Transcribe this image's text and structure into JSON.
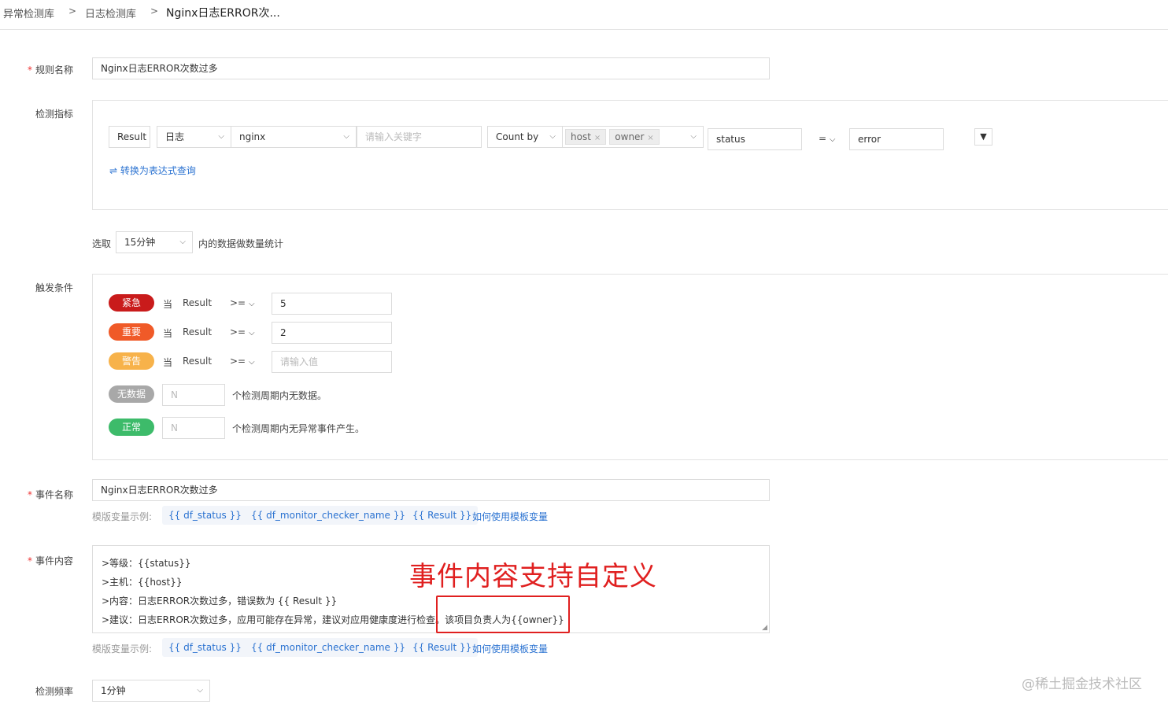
{
  "breadcrumb": {
    "items": [
      "异常检测库",
      "日志检测库",
      "Nginx日志ERROR次..."
    ],
    "separator": ">"
  },
  "rule_name": {
    "label": "规则名称",
    "value": "Nginx日志ERROR次数过多"
  },
  "metric": {
    "label": "检测指标",
    "result_label": "Result",
    "source_select": "日志",
    "source_value": "nginx",
    "keyword_placeholder": "请输入关键字",
    "count_by": "Count by",
    "tags": [
      "host",
      "owner"
    ],
    "filter_field": "status",
    "operator": "=",
    "filter_value": "error",
    "convert_link": "⇌ 转换为表达式查询"
  },
  "window": {
    "prefix": "选取",
    "value": "15分钟",
    "suffix": "内的数据做数量统计"
  },
  "trigger": {
    "label": "触发条件",
    "rows": [
      {
        "level": "紧急",
        "color": "#c91b1b",
        "when": "当",
        "metric": "Result",
        "op": ">=",
        "value": "5",
        "placeholder": ""
      },
      {
        "level": "重要",
        "color": "#f05a28",
        "when": "当",
        "metric": "Result",
        "op": ">=",
        "value": "2",
        "placeholder": ""
      },
      {
        "level": "警告",
        "color": "#f7b24a",
        "when": "当",
        "metric": "Result",
        "op": ">=",
        "value": "",
        "placeholder": "请输入值"
      }
    ],
    "nodata": {
      "level": "无数据",
      "color": "#a8a8a8",
      "placeholder": "N",
      "text": "个检测周期内无数据。"
    },
    "normal": {
      "level": "正常",
      "color": "#3dbb6a",
      "placeholder": "N",
      "text": "个检测周期内无异常事件产生。"
    }
  },
  "event_name": {
    "label": "事件名称",
    "value": "Nginx日志ERROR次数过多"
  },
  "template_vars": {
    "label": "模版变量示例:",
    "chips": [
      "{{ df_status }}",
      "{{ df_monitor_checker_name }}",
      "{{ Result }}"
    ],
    "help_link": "如何使用模板变量"
  },
  "event_content": {
    "label": "事件内容",
    "lines": [
      ">等级：{{status}}",
      ">主机：{{host}}",
      ">内容：日志ERROR次数过多，错误数为 {{ Result }}",
      ">建议：日志ERROR次数过多，应用可能存在异常，建议对应用健康度进行检查。该项目负责人为{{owner}}"
    ]
  },
  "annotation": {
    "text": "事件内容支持自定义"
  },
  "frequency": {
    "label": "检测频率",
    "value": "1分钟"
  },
  "watermark": "@稀土掘金技术社区",
  "colors": {
    "link": "#2a72d1",
    "required": "#e33333",
    "annotation": "#e02020"
  }
}
